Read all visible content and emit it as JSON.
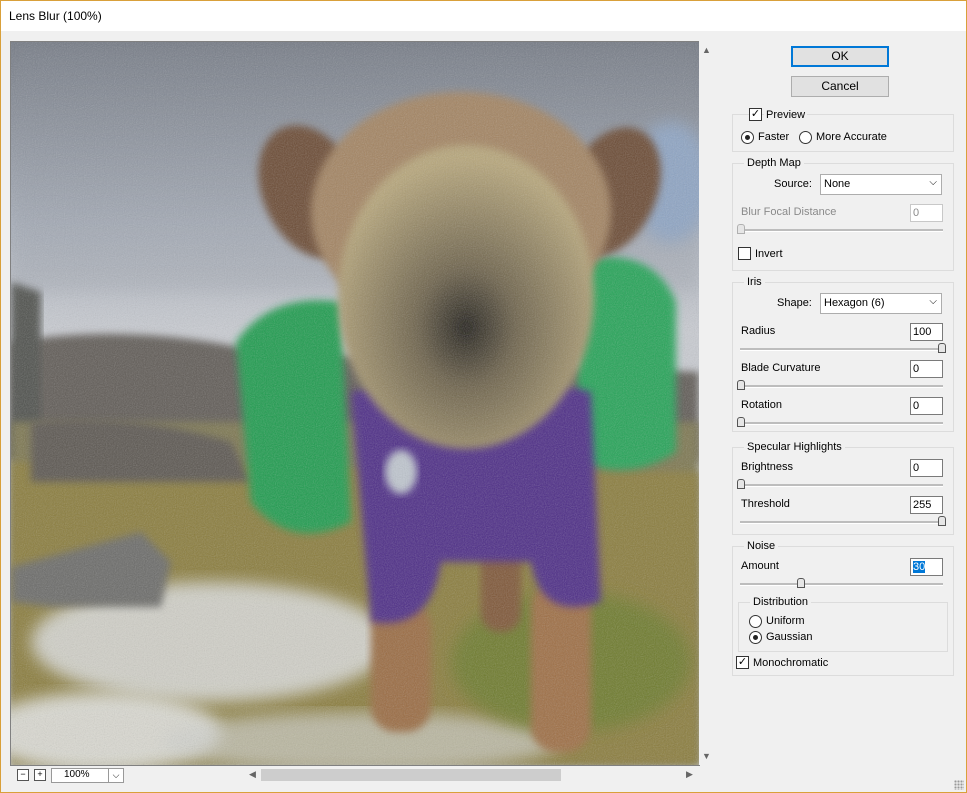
{
  "window": {
    "title": "Lens Blur (100%)"
  },
  "toolbar": {
    "zoom_out": "−",
    "zoom_in": "+",
    "zoom_value": "100%"
  },
  "buttons": {
    "ok": "OK",
    "cancel": "Cancel"
  },
  "preview_options": {
    "preview_label": "Preview",
    "preview_checked": true,
    "faster_label": "Faster",
    "more_accurate_label": "More Accurate",
    "selected": "Faster"
  },
  "depth_map": {
    "title": "Depth Map",
    "source_label": "Source:",
    "source_value": "None",
    "blur_focal_label": "Blur Focal Distance",
    "blur_focal_value": "0",
    "invert_label": "Invert",
    "invert_checked": false
  },
  "iris": {
    "title": "Iris",
    "shape_label": "Shape:",
    "shape_value": "Hexagon (6)",
    "radius_label": "Radius",
    "radius_value": "100",
    "blade_label": "Blade Curvature",
    "blade_value": "0",
    "rotation_label": "Rotation",
    "rotation_value": "0"
  },
  "specular": {
    "title": "Specular Highlights",
    "brightness_label": "Brightness",
    "brightness_value": "0",
    "threshold_label": "Threshold",
    "threshold_value": "255"
  },
  "noise": {
    "title": "Noise",
    "amount_label": "Amount",
    "amount_value": "30",
    "distribution_title": "Distribution",
    "uniform_label": "Uniform",
    "gaussian_label": "Gaussian",
    "distribution_selected": "Gaussian",
    "mono_label": "Monochromatic",
    "mono_checked": true
  },
  "slider_levels": {
    "blur_focal": 0,
    "radius": 1.0,
    "blade": 0,
    "rotation": 0,
    "brightness": 0,
    "threshold": 1.0,
    "amount": 0.3
  },
  "icons": {
    "dropdown": "chevron-down-icon",
    "check": "checkmark-icon"
  }
}
